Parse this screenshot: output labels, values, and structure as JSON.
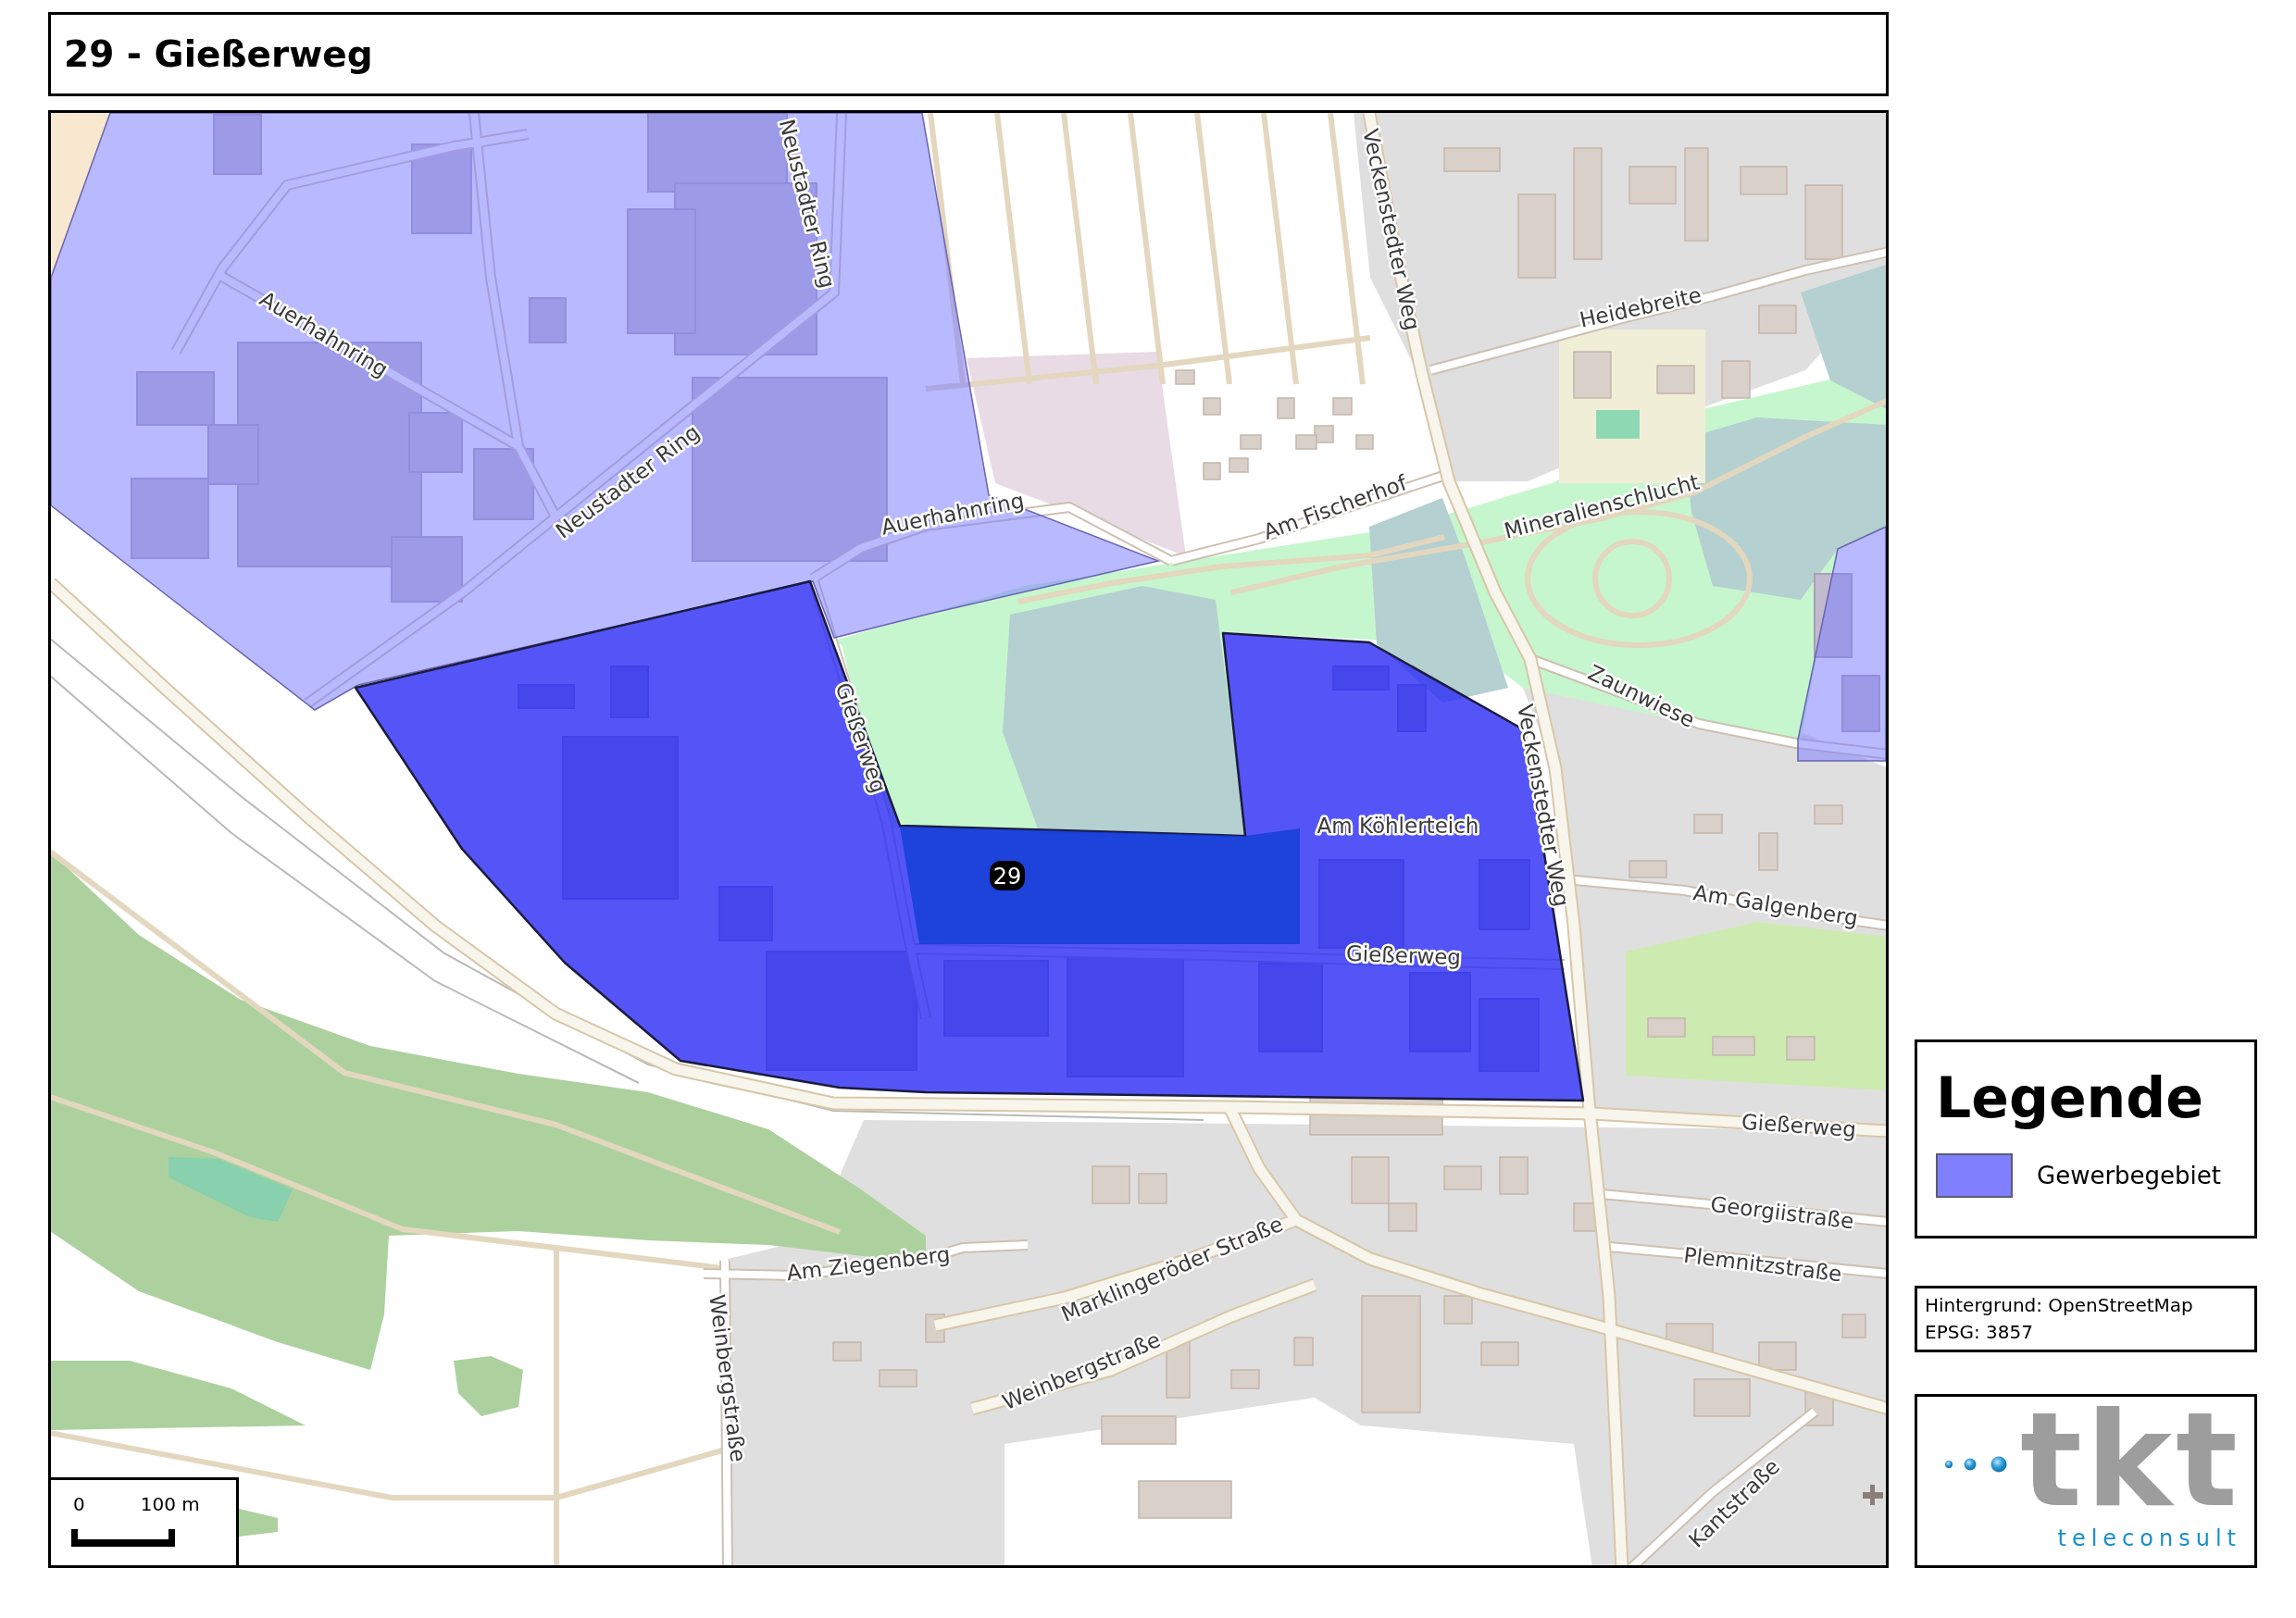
{
  "title": "29 - Gießerweg",
  "map": {
    "street_labels": [
      "Neustadter Ring",
      "Veckenstedter Weg",
      "Heidebreite",
      "Auerhahnring",
      "Neustadter Ring",
      "Mineralienschlucht",
      "Am Fischerhof",
      "Auerhahnring",
      "Zaunwiese",
      "Gießerweg",
      "Veckenstedter Weg",
      "Am Köhlerteich",
      "Am Galgenberg",
      "Gießerweg",
      "Gießerweg",
      "Georgiistraße",
      "Am Ziegenberg",
      "Plemnitzstraße",
      "Marklingeröder Straße",
      "Weinbergstraße",
      "Weinbergstraße",
      "Kantstraße"
    ],
    "zones": [
      {
        "label": "29"
      }
    ],
    "scale_bar": {
      "labels": [
        "0",
        "100 m"
      ]
    }
  },
  "legend": {
    "title": "Legende",
    "items": [
      {
        "label": "Gewerbegebiet",
        "color": "#8080ff"
      }
    ]
  },
  "attribution": {
    "lines": [
      "Hintergrund: OpenStreetMap",
      "EPSG: 3857"
    ]
  },
  "logo": {
    "wordmark": "tkt",
    "tagline": "teleconsult"
  }
}
